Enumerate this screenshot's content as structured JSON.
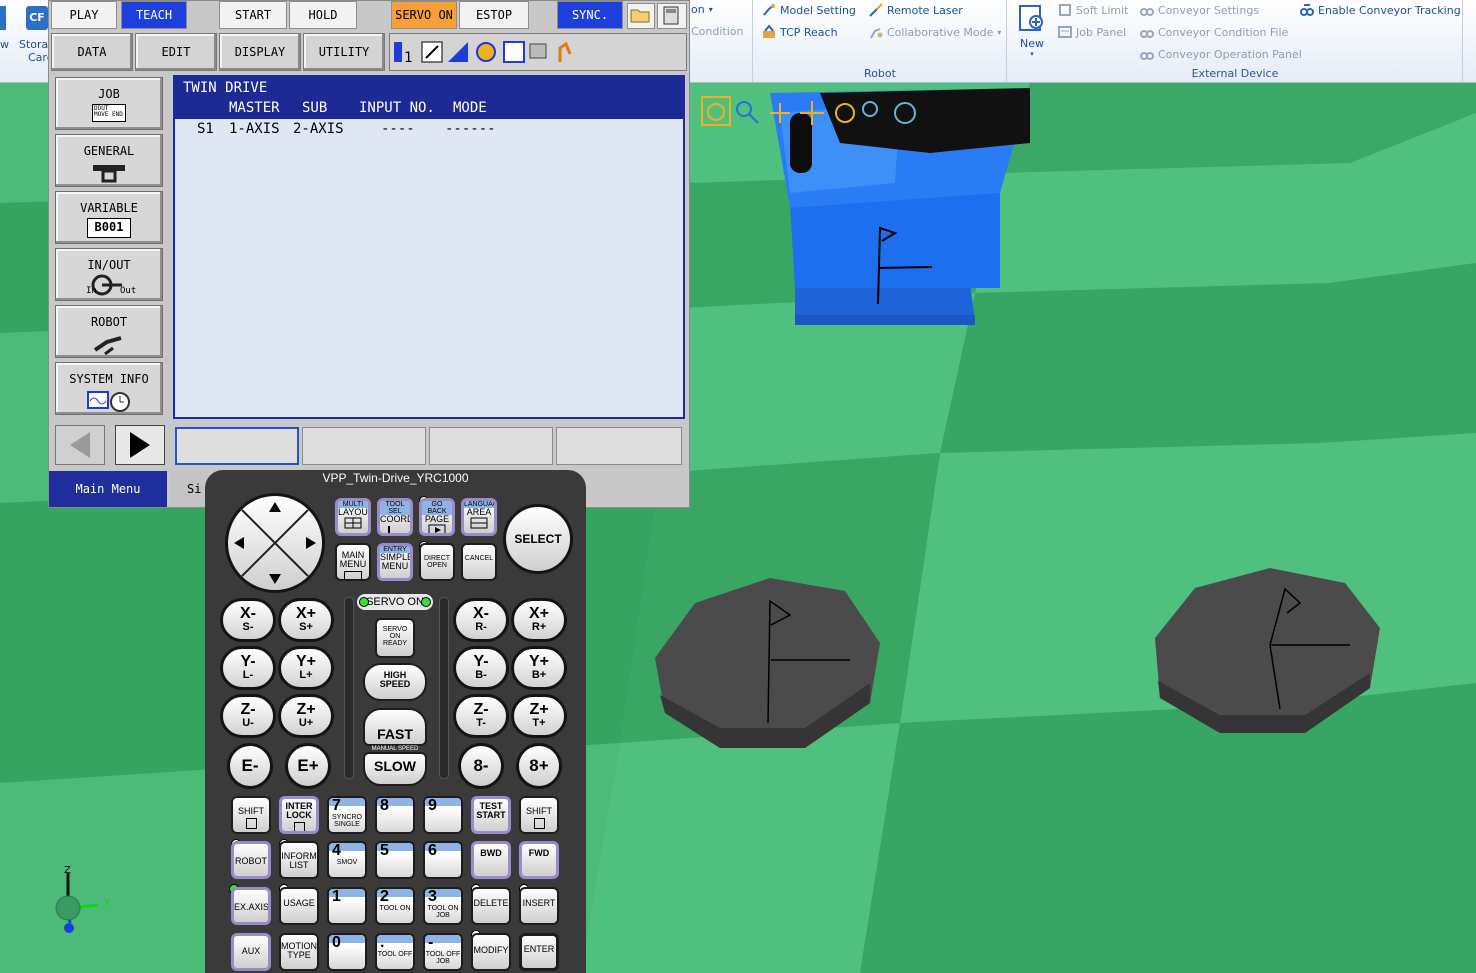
{
  "ribbon": {
    "left_fragments": {
      "w": "w",
      "storage": "Storag",
      "card": "Card",
      "cf": "CF"
    },
    "frag_ion": "ion",
    "frag_condition": "Condition",
    "robot_group": {
      "label": "Robot",
      "items": {
        "model_setting": "Model Setting",
        "tcp_reach": "TCP Reach",
        "remote_laser": "Remote Laser",
        "collaborative_mode": "Collaborative Mode"
      }
    },
    "external_group": {
      "label": "External Device",
      "items": {
        "new": "New",
        "soft_limit": "Soft Limit",
        "job_panel": "Job Panel",
        "conveyor_settings": "Conveyor Settings",
        "conveyor_condition_file": "Conveyor Condition File",
        "conveyor_operation_panel": "Conveyor Operation Panel",
        "enable_conveyor_tracking": "Enable Conveyor Tracking"
      }
    }
  },
  "pendant": {
    "top_buttons": {
      "play": "PLAY",
      "teach": "TEACH",
      "start": "START",
      "hold": "HOLD",
      "servo_on": "SERVO ON",
      "estop": "ESTOP",
      "sync": "SYNC."
    },
    "menu_buttons": {
      "data": "DATA",
      "edit": "EDIT",
      "display": "DISPLAY",
      "utility": "UTILITY"
    },
    "side_buttons": {
      "job": "JOB",
      "general": "GENERAL",
      "variable": "VARIABLE",
      "variable_value": "B001",
      "inout": "IN/OUT",
      "robot": "ROBOT",
      "system_info": "SYSTEM INFO",
      "job_icon_text": "DOUT MOVE END",
      "in": "In",
      "out": "Out"
    },
    "screen": {
      "title": "TWIN DRIVE",
      "columns": {
        "master": "MASTER",
        "sub": "SUB",
        "input_no": "INPUT NO.",
        "mode": "MODE"
      },
      "rows": [
        {
          "id": "S1",
          "master": "1-AXIS",
          "sub": "2-AXIS",
          "input_no": "----",
          "mode": "------"
        }
      ]
    },
    "main_menu": "Main Menu",
    "simple_fragment": "Si"
  },
  "keypad": {
    "title": "VPP_Twin-Drive_YRC1000",
    "keys": {
      "multi": "MULTI",
      "layout": "LAYOUT",
      "tool_sel": "TOOL SEL",
      "coord": "COORD",
      "go_back": "GO BACK",
      "page": "PAGE",
      "language": "LANGUAGE",
      "area": "AREA",
      "select": "SELECT",
      "main_menu_1": "MAIN",
      "main_menu_2": "MENU",
      "entry": "ENTRY",
      "simple_menu_1": "SIMPLE",
      "simple_menu_2": "MENU",
      "direct_open_1": "DIRECT",
      "direct_open_2": "OPEN",
      "cancel": "CANCEL",
      "servo_on_led": "SERVO ON",
      "servo_on_ready_1": "SERVO",
      "servo_on_ready_2": "ON",
      "servo_on_ready_3": "READY",
      "high_speed_1": "HIGH",
      "high_speed_2": "SPEED",
      "fast": "FAST",
      "manual_speed": "MANUAL SPEED",
      "slow": "SLOW",
      "xm": "X-",
      "sm": "S-",
      "xp": "X+",
      "sp": "S+",
      "ym": "Y-",
      "lm": "L-",
      "yp": "Y+",
      "lp": "L+",
      "zm": "Z-",
      "um": "U-",
      "zp": "Z+",
      "up": "U+",
      "em": "E-",
      "ep": "E+",
      "rxm": "X-",
      "rm": "R-",
      "rxp": "X+",
      "rp": "R+",
      "rym": "Y-",
      "bm": "B-",
      "ryp": "Y+",
      "bp": "B+",
      "rzm": "Z-",
      "tm": "T-",
      "rzp": "Z+",
      "tp": "T+",
      "eightm": "8-",
      "eightp": "8+",
      "shift": "SHIFT",
      "interlock_1": "INTER",
      "interlock_2": "LOCK",
      "n7": "7",
      "syncro_single_1": "SYNCRO",
      "syncro_single_2": "SINGLE",
      "n8": "8",
      "n9": "9",
      "test_start_1": "TEST",
      "test_start_2": "START",
      "robot": "ROBOT",
      "inform_list_1": "INFORM",
      "inform_list_2": "LIST",
      "n4": "4",
      "smov": "SMOV",
      "n5": "5",
      "n6": "6",
      "bwd": "BWD",
      "fwd": "FWD",
      "exaxis": "EX.AXIS",
      "usage": "USAGE",
      "n1": "1",
      "n2": "2",
      "tool_on": "TOOL ON",
      "n3": "3",
      "tool_on_job_1": "TOOL ON",
      "tool_on_job_2": "JOB",
      "delete": "DELETE",
      "insert": "INSERT",
      "aux": "AUX",
      "motion_type_1": "MOTION",
      "motion_type_2": "TYPE",
      "n0": "0",
      "dot": ".",
      "tool_off": "TOOL OFF",
      "minus": "-",
      "tool_off_job_1": "TOOL OFF",
      "tool_off_job_2": "JOB",
      "modify": "MODIFY",
      "enter": "ENTER"
    }
  },
  "axes": {
    "z": "Z",
    "y": "Y",
    "x": "X"
  },
  "colors": {
    "pendant_blue": "#1e2a94",
    "teach_blue": "#1f3fdc",
    "servo_orange": "#f7a03a",
    "floor_light": "#4fc07d",
    "floor_dark": "#34a25f",
    "robot_blue": "#1e6ef0"
  }
}
